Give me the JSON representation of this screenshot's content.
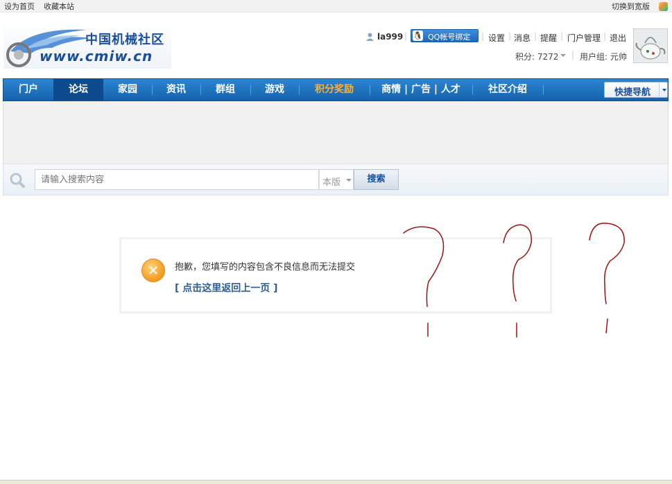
{
  "topbar": {
    "set_homepage": "设为首页",
    "bookmark": "收藏本站",
    "switch_wide": "切换到宽版"
  },
  "logo": {
    "site_name_cn": "中国机械社区",
    "site_url": "www.cmiw.cn"
  },
  "user": {
    "username": "la999",
    "qq_bind_label": "QQ帐号绑定",
    "links": [
      "设置",
      "消息",
      "提醒",
      "门户管理",
      "退出"
    ],
    "points_label": "积分: 7272",
    "usergroup_label": "用户组: 元帅"
  },
  "nav": {
    "items": [
      "门户",
      "论坛",
      "家园",
      "资讯",
      "群组",
      "游戏",
      "积分奖励",
      "商情 | 广告 | 人才",
      "社区介绍"
    ],
    "active_index": 1,
    "highlight_index": 6,
    "quick_nav": "快捷导航"
  },
  "search": {
    "placeholder": "请输入搜索内容",
    "scope": "本版",
    "button": "搜索"
  },
  "message": {
    "text": "抱歉，您填写的内容包含不良信息而无法提交",
    "back_link": "[ 点击这里返回上一页 ]"
  },
  "colors": {
    "nav_bg": "#1c6cb8",
    "highlight": "#ffb02e",
    "link": "#2e5d95",
    "scribble": "#a01010"
  }
}
